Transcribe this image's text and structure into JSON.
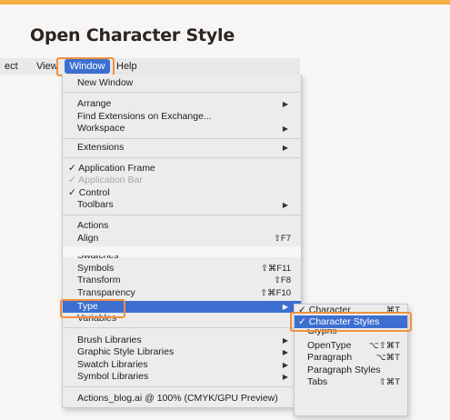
{
  "title": "Open Character Style",
  "menubar": {
    "items": [
      "ect",
      "View",
      "Window",
      "Help"
    ],
    "active": "Window"
  },
  "window_menu": {
    "new_window": "New Window",
    "arrange": "Arrange",
    "find_ext": "Find Extensions on Exchange...",
    "workspace": "Workspace",
    "extensions": "Extensions",
    "application_frame": "Application Frame",
    "application_bar": "Application Bar",
    "control": "Control",
    "toolbars": "Toolbars",
    "actions": "Actions",
    "align": "Align",
    "align_sc": "⇧F7",
    "swatches": "Swatches",
    "symbols": "Symbols",
    "symbols_sc": "⇧⌘F11",
    "transform": "Transform",
    "transform_sc": "⇧F8",
    "transparency": "Transparency",
    "transparency_sc": "⇧⌘F10",
    "type": "Type",
    "variables": "Variables",
    "brush_libraries": "Brush Libraries",
    "graphic_style_libraries": "Graphic Style Libraries",
    "swatch_libraries": "Swatch Libraries",
    "symbol_libraries": "Symbol Libraries",
    "document": "Actions_blog.ai @ 100% (CMYK/GPU Preview)"
  },
  "type_submenu": {
    "character": "Character",
    "character_sc": "⌘T",
    "character_styles": "Character Styles",
    "glyphs": "Glyphs",
    "opentype": "OpenType",
    "opentype_sc": "⌥⇧⌘T",
    "paragraph": "Paragraph",
    "paragraph_sc": "⌥⌘T",
    "paragraph_styles": "Paragraph Styles",
    "tabs": "Tabs",
    "tabs_sc": "⇧⌘T"
  },
  "glyphs": {
    "check": "✓",
    "arrow": "▶"
  },
  "colors": {
    "accent": "#f2b045",
    "highlight": "#3d6fd0",
    "annotation": "#f0913e"
  }
}
